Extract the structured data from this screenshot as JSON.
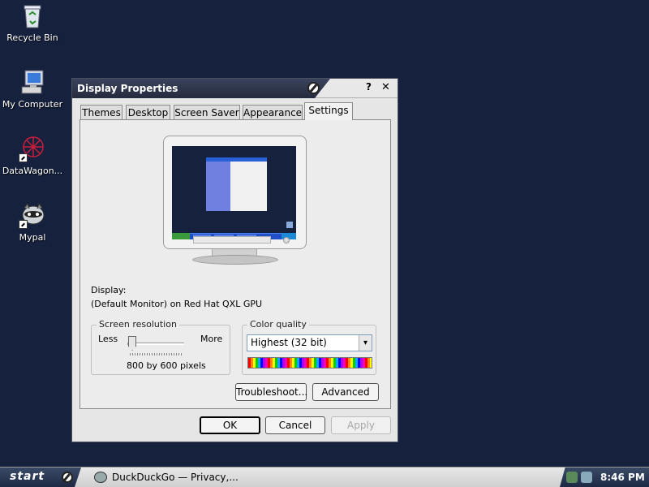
{
  "desktop": {
    "icons": [
      {
        "label": "Recycle Bin",
        "icon": "recycle-bin-icon"
      },
      {
        "label": "My Computer",
        "icon": "my-computer-icon"
      },
      {
        "label": "DataWagon...",
        "icon": "datawagon-icon"
      },
      {
        "label": "Mypal",
        "icon": "mypal-icon"
      }
    ]
  },
  "window": {
    "title": "Display Properties",
    "help_label": "?",
    "close_label": "✕",
    "tabs": [
      {
        "label": "Themes",
        "active": false
      },
      {
        "label": "Desktop",
        "active": false
      },
      {
        "label": "Screen Saver",
        "active": false
      },
      {
        "label": "Appearance",
        "active": false
      },
      {
        "label": "Settings",
        "active": true
      }
    ],
    "display": {
      "label": "Display:",
      "value": "(Default Monitor) on Red Hat QXL GPU"
    },
    "screen_resolution": {
      "legend": "Screen resolution",
      "less_label": "Less",
      "more_label": "More",
      "value_text": "800 by 600 pixels",
      "slider_level": 0
    },
    "color_quality": {
      "legend": "Color quality",
      "selected": "Highest (32 bit)",
      "dropdown_arrow": "▾"
    },
    "buttons": {
      "troubleshoot": "Troubleshoot...",
      "advanced": "Advanced",
      "ok": "OK",
      "cancel": "Cancel",
      "apply": "Apply"
    }
  },
  "taskbar": {
    "start_label": "start",
    "tasks": [
      {
        "label": "DuckDuckGo — Privacy,...",
        "icon": "mypal-icon"
      }
    ],
    "clock": "8:46 PM"
  },
  "colors": {
    "desktop_bg": "#15213d",
    "titlebar": "#2c3449",
    "window_bg": "#e6e6e6"
  }
}
